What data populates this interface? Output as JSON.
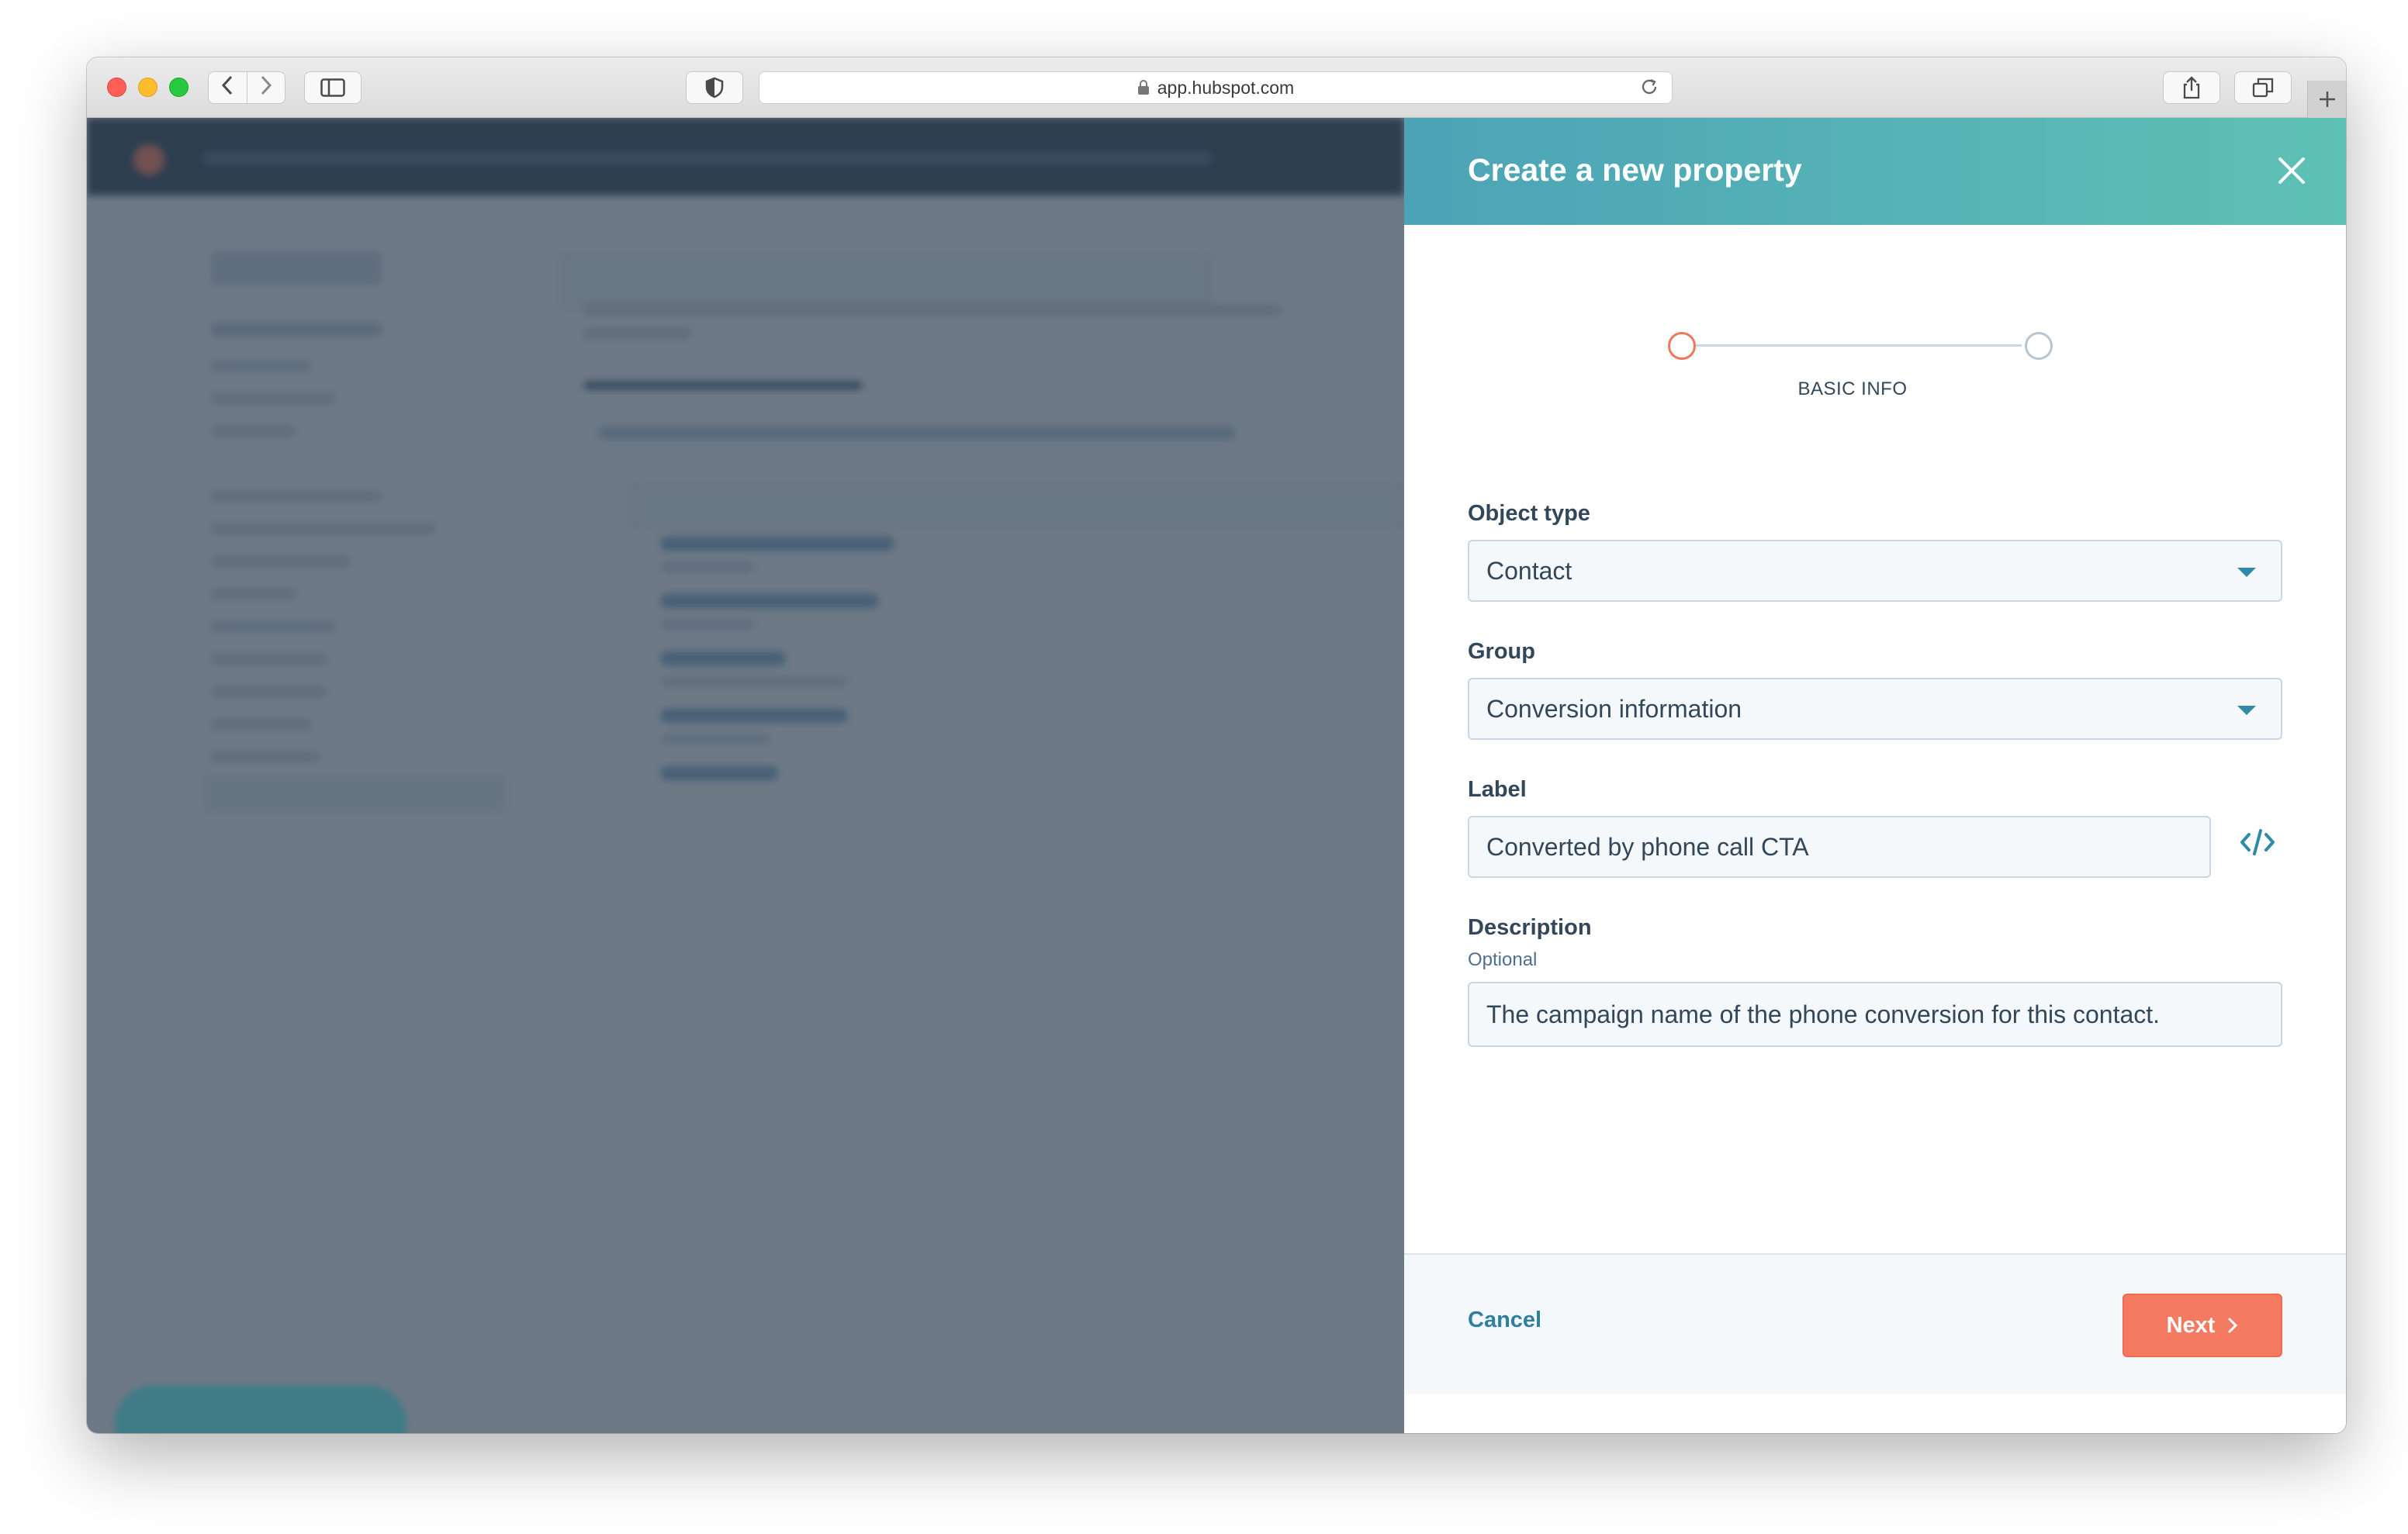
{
  "browser": {
    "url": "app.hubspot.com",
    "icons": {
      "back": "chevron-left-icon",
      "forward": "chevron-right-icon",
      "sidebar": "sidebar-icon",
      "shield": "shield-icon",
      "lock": "lock-icon",
      "reload": "reload-icon",
      "share": "share-icon",
      "tabs": "tabs-icon",
      "new_tab": "plus-icon"
    }
  },
  "panel": {
    "title": "Create a new property",
    "stepper": {
      "current_step_label": "BASIC INFO",
      "total_steps": 2,
      "current_step": 1
    },
    "fields": {
      "object_type": {
        "label": "Object type",
        "value": "Contact"
      },
      "group": {
        "label": "Group",
        "value": "Conversion information"
      },
      "label": {
        "label": "Label",
        "value": "Converted by phone call CTA"
      },
      "description": {
        "label": "Description",
        "sublabel": "Optional",
        "value": "The campaign name of the phone conversion for this contact."
      }
    },
    "footer": {
      "cancel_label": "Cancel",
      "next_label": "Next"
    }
  },
  "colors": {
    "header_gradient_start": "#4ca3b6",
    "header_gradient_end": "#5ec1b5",
    "accent_orange": "#f47b62",
    "link_blue": "#2f7fa0",
    "text_dark": "#33475b",
    "overlay": "#2d3e50"
  }
}
